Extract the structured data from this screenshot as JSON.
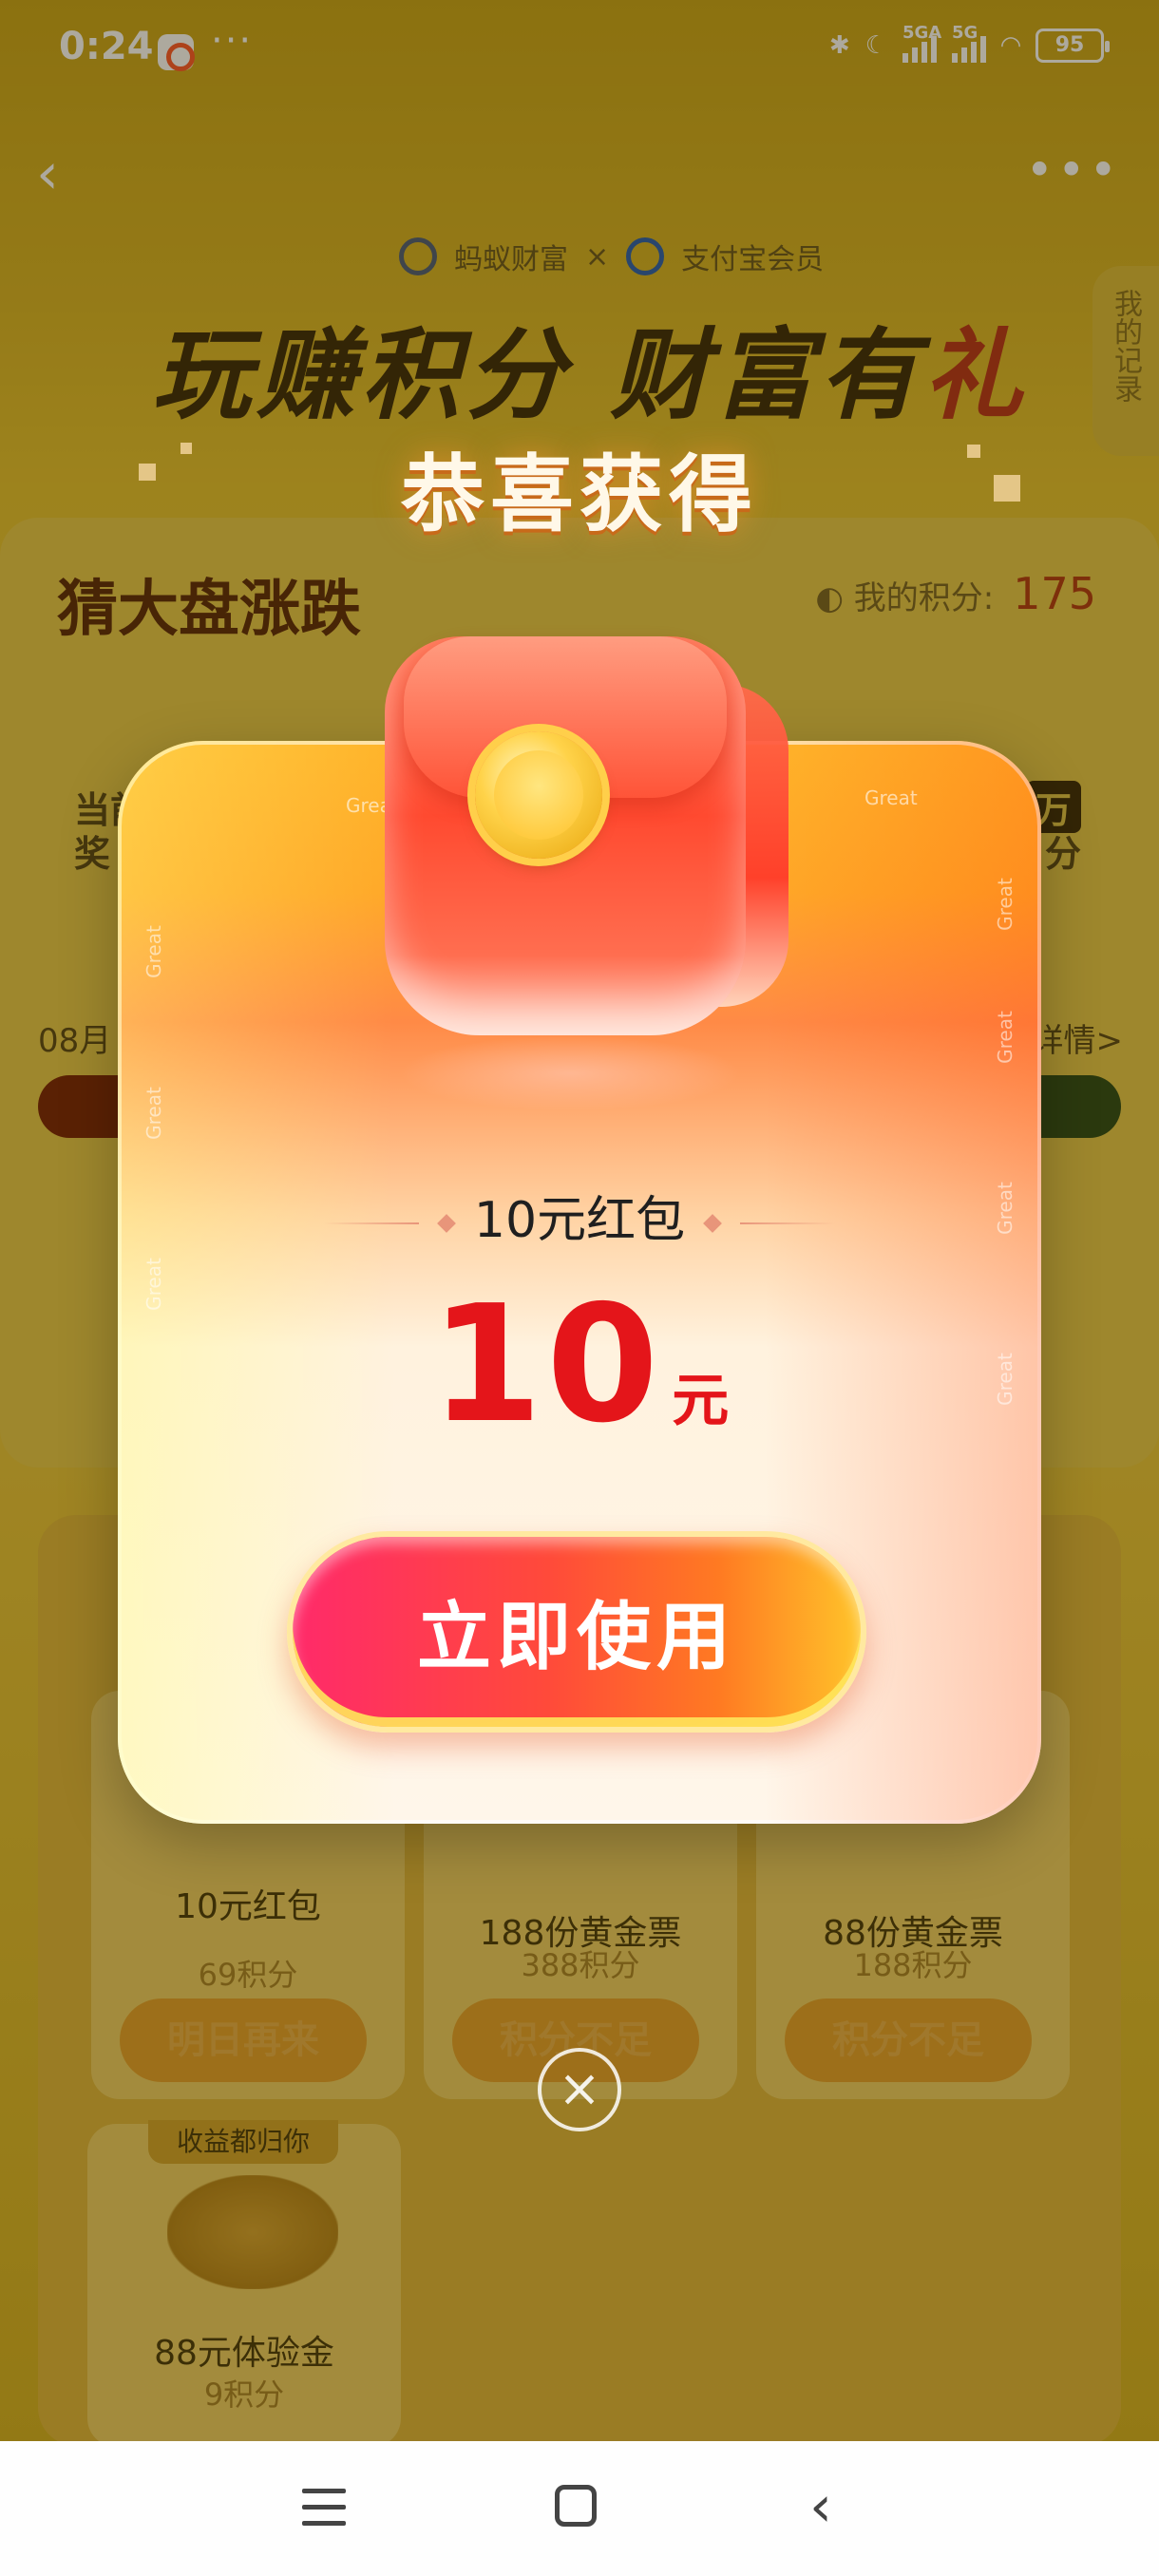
{
  "status_bar": {
    "time": "0:24",
    "more": "···",
    "sig1_label": "5GA",
    "sig2_label": "5G",
    "battery": "95"
  },
  "nav": {
    "back": "‹",
    "more": "•••"
  },
  "header": {
    "brand_left": "蚂蚁财富",
    "brand_x": "×",
    "brand_right": "支付宝会员",
    "title_main": "玩赚积分 财富有",
    "title_gift": "礼",
    "records_tab": "我的记录"
  },
  "guess": {
    "title": "猜大盘涨跌",
    "points_label": "我的积分:",
    "points_value": "175",
    "left_text_1": "当前",
    "left_text_2": "奖",
    "right_badge": "万",
    "right_text": "分",
    "date_prefix": "08月",
    "details": "详情>"
  },
  "modal": {
    "congrats": "恭喜获得",
    "great": "Great",
    "prize_name": "10元红包",
    "amount": "10",
    "unit": "元",
    "use_button": "立即使用"
  },
  "cards": [
    {
      "name": "10元红包",
      "cost": "69积分",
      "button": "明日再来"
    },
    {
      "name": "188份黄金票",
      "cost": "388积分",
      "button": "积分不足"
    },
    {
      "name": "88份黄金票",
      "cost": "188积分",
      "button": "积分不足"
    }
  ],
  "card4": {
    "tag": "收益都归你",
    "name": "88元体验金",
    "cost": "9积分"
  },
  "close_symbol": "×",
  "colors": {
    "accent_red": "#e4151a",
    "button_gradient_start": "#ff2a6a",
    "button_gradient_end": "#ffc42a",
    "modal_top": "#ffb42a"
  }
}
